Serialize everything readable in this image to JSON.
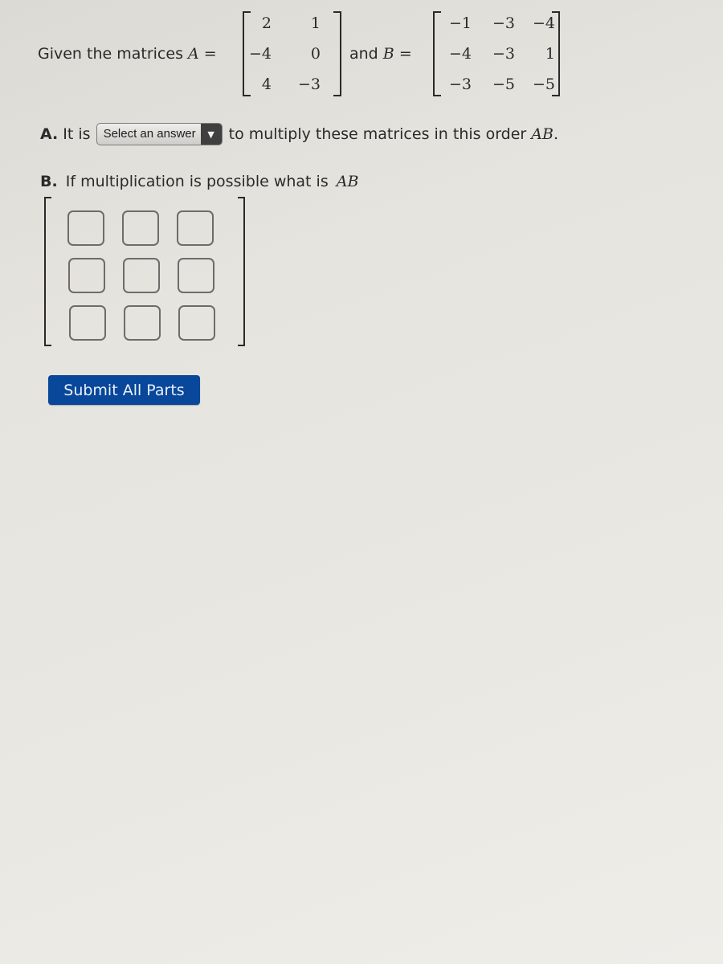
{
  "question": {
    "intro_text": "Given the matrices",
    "matrix_a_name": "A",
    "equals": "=",
    "and_text": "and",
    "matrix_b_name": "B",
    "matrix_a": [
      [
        "2",
        "1"
      ],
      [
        "−4",
        "0"
      ],
      [
        "4",
        "−3"
      ]
    ],
    "matrix_b": [
      [
        "−1",
        "−3",
        "−4"
      ],
      [
        "−4",
        "−3",
        "1"
      ],
      [
        "−3",
        "−5",
        "−5"
      ]
    ]
  },
  "part_a": {
    "label": "A.",
    "prefix": "It is",
    "select_value": "Select an answer",
    "select_arrow_icon": "▼",
    "suffix": "to multiply these matrices in this order",
    "order": "AB",
    "period": "."
  },
  "part_b": {
    "label": "B.",
    "text": "If multiplication is possible what is",
    "product": "AB",
    "answer_cells": [
      [
        "",
        "",
        ""
      ],
      [
        "",
        "",
        ""
      ],
      [
        "",
        "",
        ""
      ]
    ]
  },
  "submit": {
    "label": "Submit All Parts",
    "color": "#08479a"
  }
}
